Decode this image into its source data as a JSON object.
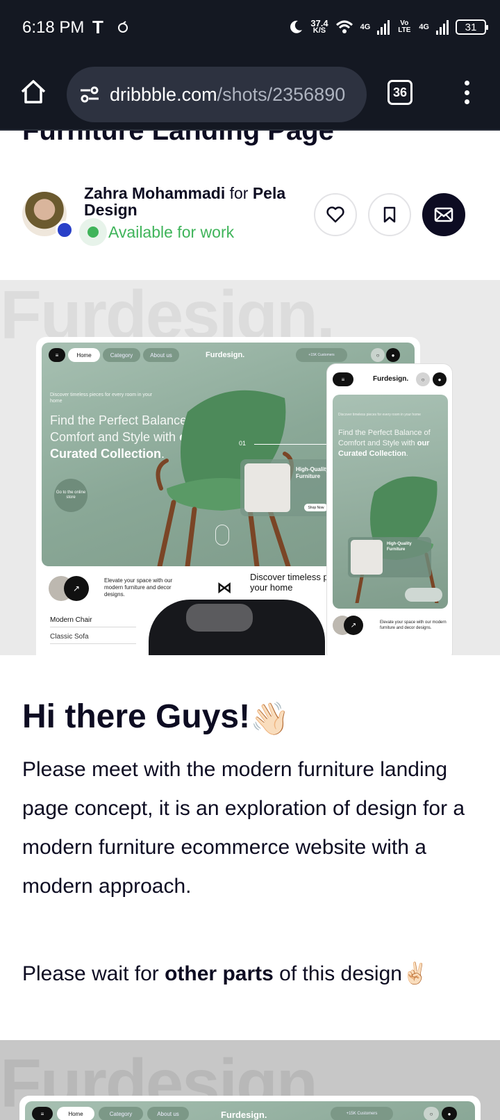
{
  "status_bar": {
    "time": "6:18 PM",
    "carrier_glyph": "T",
    "speed_value": "37.4",
    "speed_unit": "K/S",
    "network_1": "4G",
    "volte": "Vo LTE",
    "network_2": "4G",
    "battery": "31"
  },
  "browser": {
    "url_domain": "dribbble.com",
    "url_path": "/shots/2356890",
    "tab_count": "36"
  },
  "shot": {
    "title": "Furniture Landing Page",
    "author_name": "Zahra Mohammadi",
    "for_word": "for",
    "team_name": "Pela Design",
    "availability": "Available for work"
  },
  "mockup": {
    "wordmark": "Furdesign.",
    "nav_home": "Home",
    "nav_category": "Category",
    "nav_about": "About us",
    "brand": "Furdesign.",
    "customers": "+15K Customers",
    "hero_small": "Discover timeless pieces for every room in your home",
    "hero_line_1": "Find the Perfect Balance of",
    "hero_line_2": "Comfort and Style with",
    "hero_bold_1": "our",
    "hero_bold_2": "Curated Collection",
    "hero_dot": ".",
    "go_button": "Go to the online store",
    "slide_num": "01",
    "card_title": "High-Quality Furniture",
    "shop_now": "Shop Now",
    "elevate": "Elevate your space with our modern furniture and decor designs.",
    "discover": "Discover timeless pieces in your home",
    "list": [
      "Modern Chair",
      "Classic Sofa"
    ]
  },
  "description": {
    "heading": "Hi there Guys!",
    "wave_emoji": "👋🏻",
    "paragraph": "Please meet with the modern furniture landing page concept, it is an exploration of design for a modern furniture ecommerce website with a modern approach.",
    "wait_prefix": "Please wait for",
    "wait_bold": "other parts",
    "wait_suffix": "of this design",
    "peace_emoji": "✌🏻"
  },
  "colors": {
    "dark_bar": "#141822",
    "available_green": "#3fb45a",
    "ink": "#0d0c22",
    "mockup_green": "#8aa897"
  },
  "icons": [
    "home-icon",
    "site-settings-icon",
    "heart-icon",
    "bookmark-icon",
    "mail-icon",
    "overflow-menu-icon"
  ]
}
